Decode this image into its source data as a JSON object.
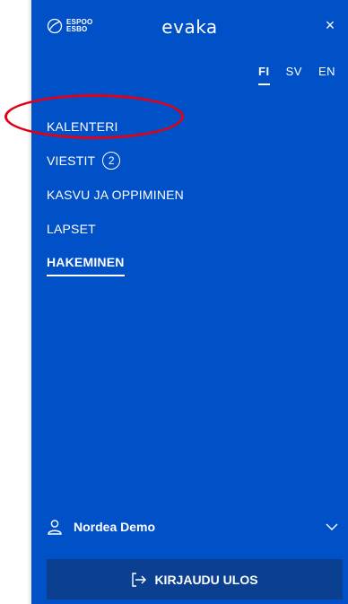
{
  "header": {
    "logo_line1": "ESPOO",
    "logo_line2": "ESBO",
    "app_name": "evaka",
    "close_symbol": "×"
  },
  "languages": [
    {
      "label": "FI",
      "active": true
    },
    {
      "label": "SV",
      "active": false
    },
    {
      "label": "EN",
      "active": false
    }
  ],
  "menu": {
    "items": [
      {
        "label": "KALENTERI"
      },
      {
        "label": "VIESTIT",
        "badge": "2"
      },
      {
        "label": "KASVU JA OPPIMINEN"
      },
      {
        "label": "LAPSET"
      },
      {
        "label": "HAKEMINEN",
        "active": true
      }
    ]
  },
  "user": {
    "name": "Nordea Demo",
    "icon": "user-icon",
    "expand_icon": "chevron-down-icon"
  },
  "logout": {
    "label": "KIRJAUDU ULOS",
    "icon": "logout-icon"
  },
  "colors": {
    "panel_bg": "#0050c8",
    "logout_bg": "#0b3f8f",
    "annotation": "#e10016"
  }
}
